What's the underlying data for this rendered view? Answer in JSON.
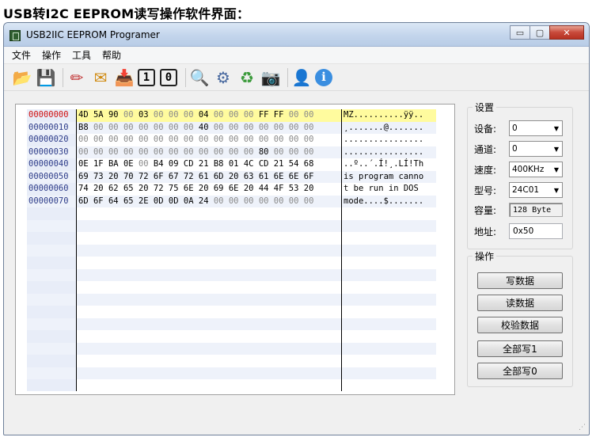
{
  "heading": "USB转I2C EEPROM读写操作软件界面：",
  "window": {
    "title": "USB2IIC EEPROM Programer",
    "min_symbol": "▭",
    "max_symbol": "▢",
    "close_symbol": "✕"
  },
  "menu": [
    "文件",
    "操作",
    "工具",
    "帮助"
  ],
  "toolbar": {
    "open_glyph": "📂",
    "save_glyph": "💾",
    "edit_glyph": "✏",
    "mail_glyph": "✉",
    "load_glyph": "📥",
    "one_label": "1",
    "zero_label": "0",
    "search_glyph": "🔍",
    "info_settings_glyph": "⚙",
    "refresh_glyph": "♻",
    "chip_glyph": "📷",
    "user_glyph": "👤",
    "about_glyph": "ℹ"
  },
  "hex": {
    "rows": [
      {
        "addr": "00000000",
        "bytes": [
          "4D",
          "5A",
          "90",
          "00",
          "03",
          "00",
          "00",
          "00",
          "04",
          "00",
          "00",
          "00",
          "FF",
          "FF",
          "00",
          "00"
        ],
        "ascii": "MZ..........ÿÿ.."
      },
      {
        "addr": "00000010",
        "bytes": [
          "B8",
          "00",
          "00",
          "00",
          "00",
          "00",
          "00",
          "00",
          "40",
          "00",
          "00",
          "00",
          "00",
          "00",
          "00",
          "00"
        ],
        "ascii": "¸.......@......."
      },
      {
        "addr": "00000020",
        "bytes": [
          "00",
          "00",
          "00",
          "00",
          "00",
          "00",
          "00",
          "00",
          "00",
          "00",
          "00",
          "00",
          "00",
          "00",
          "00",
          "00"
        ],
        "ascii": "................"
      },
      {
        "addr": "00000030",
        "bytes": [
          "00",
          "00",
          "00",
          "00",
          "00",
          "00",
          "00",
          "00",
          "00",
          "00",
          "00",
          "00",
          "80",
          "00",
          "00",
          "00"
        ],
        "ascii": "................"
      },
      {
        "addr": "00000040",
        "bytes": [
          "0E",
          "1F",
          "BA",
          "0E",
          "00",
          "B4",
          "09",
          "CD",
          "21",
          "B8",
          "01",
          "4C",
          "CD",
          "21",
          "54",
          "68"
        ],
        "ascii": "..º..´.Í!¸.LÍ!Th"
      },
      {
        "addr": "00000050",
        "bytes": [
          "69",
          "73",
          "20",
          "70",
          "72",
          "6F",
          "67",
          "72",
          "61",
          "6D",
          "20",
          "63",
          "61",
          "6E",
          "6E",
          "6F"
        ],
        "ascii": "is program canno"
      },
      {
        "addr": "00000060",
        "bytes": [
          "74",
          "20",
          "62",
          "65",
          "20",
          "72",
          "75",
          "6E",
          "20",
          "69",
          "6E",
          "20",
          "44",
          "4F",
          "53",
          "20"
        ],
        "ascii": "t be run in DOS "
      },
      {
        "addr": "00000070",
        "bytes": [
          "6D",
          "6F",
          "64",
          "65",
          "2E",
          "0D",
          "0D",
          "0A",
          "24",
          "00",
          "00",
          "00",
          "00",
          "00",
          "00",
          "00"
        ],
        "ascii": "mode....$......."
      }
    ]
  },
  "settings": {
    "group_label": "设置",
    "device_label": "设备:",
    "device_value": "0",
    "channel_label": "通道:",
    "channel_value": "0",
    "speed_label": "速度:",
    "speed_value": "400KHz",
    "model_label": "型号:",
    "model_value": "24C01",
    "capacity_label": "容量:",
    "capacity_value": "128 Byte",
    "address_label": "地址:",
    "address_value": "0x50"
  },
  "operations": {
    "group_label": "操作",
    "write_label": "写数据",
    "read_label": "读数据",
    "verify_label": "校验数据",
    "write_all1_label": "全部写1",
    "write_all0_label": "全部写0"
  }
}
